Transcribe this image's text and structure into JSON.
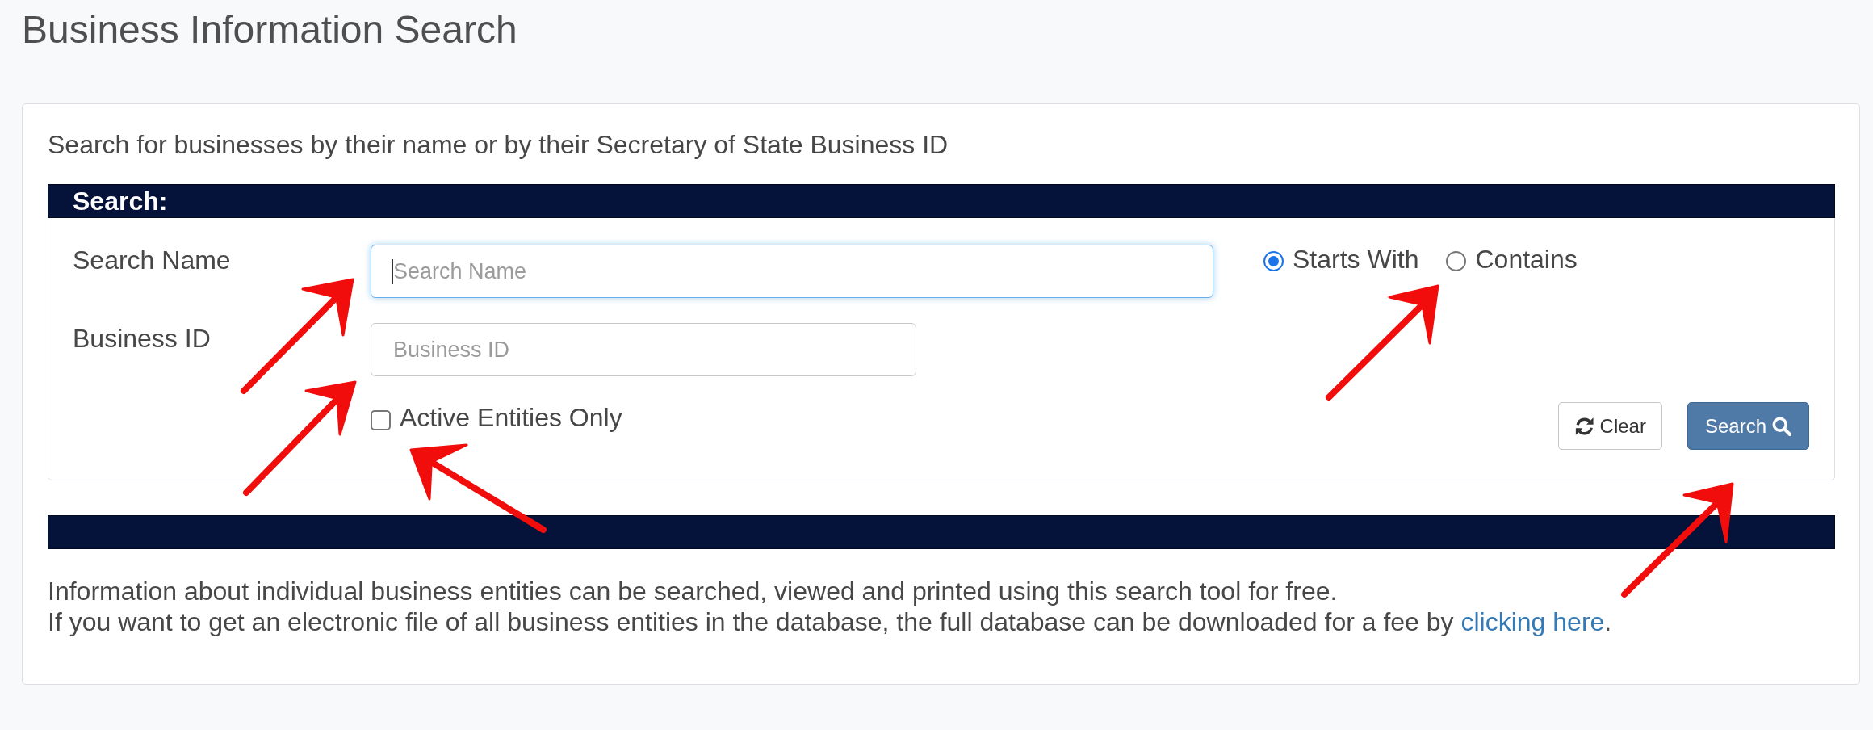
{
  "page": {
    "title": "Business Information Search"
  },
  "card": {
    "intro": "Search for businesses by their name or by their Secretary of State Business ID",
    "search_panel": {
      "heading": "Search:",
      "fields": [
        {
          "label": "Search Name",
          "placeholder": "Search Name",
          "focused": true
        },
        {
          "label": "Business ID",
          "placeholder": "Business ID",
          "focused": false
        }
      ],
      "match_options": [
        {
          "label": "Starts With",
          "selected": true
        },
        {
          "label": "Contains",
          "selected": false
        }
      ],
      "active_only": {
        "label": "Active Entities Only",
        "checked": false
      },
      "buttons": [
        {
          "kind": "clear",
          "label": "Clear"
        },
        {
          "kind": "search",
          "label": "Search"
        }
      ]
    },
    "info": [
      {
        "text": "Information about individual business entities can be searched, viewed and printed using this search tool for free."
      },
      {
        "text": "If you want to get an electronic file of all business entities in the database, the full database can be downloaded for a fee by",
        "link": "clicking here",
        "after": "."
      }
    ]
  },
  "annotations": [
    {
      "kind": "arrow"
    },
    {
      "kind": "arrow"
    },
    {
      "kind": "arrow"
    },
    {
      "kind": "arrow"
    },
    {
      "kind": "arrow"
    }
  ]
}
